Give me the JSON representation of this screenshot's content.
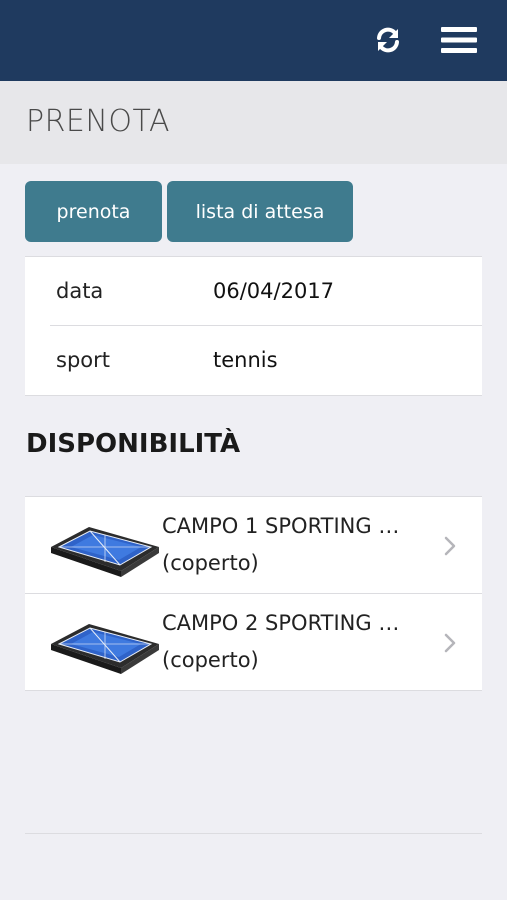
{
  "header": {
    "refresh_icon": "refresh-icon",
    "menu_icon": "hamburger-menu-icon",
    "bar_color": "#1f3a5f"
  },
  "page": {
    "title": "PRENOTA"
  },
  "actions": {
    "prenota_label": "prenota",
    "lista_label": "lista di attesa",
    "button_color": "#3f7b8e"
  },
  "form": {
    "rows": [
      {
        "label": "data",
        "value": "06/04/2017"
      },
      {
        "label": "sport",
        "value": "tennis"
      }
    ]
  },
  "availability": {
    "title": "DISPONIBILITÀ",
    "courts": [
      {
        "name": "CAMPO 1 SPORTING …",
        "detail": "(coperto)",
        "icon": "tennis-court-icon"
      },
      {
        "name": "CAMPO 2 SPORTING …",
        "detail": "(coperto)",
        "icon": "tennis-court-icon"
      }
    ]
  }
}
